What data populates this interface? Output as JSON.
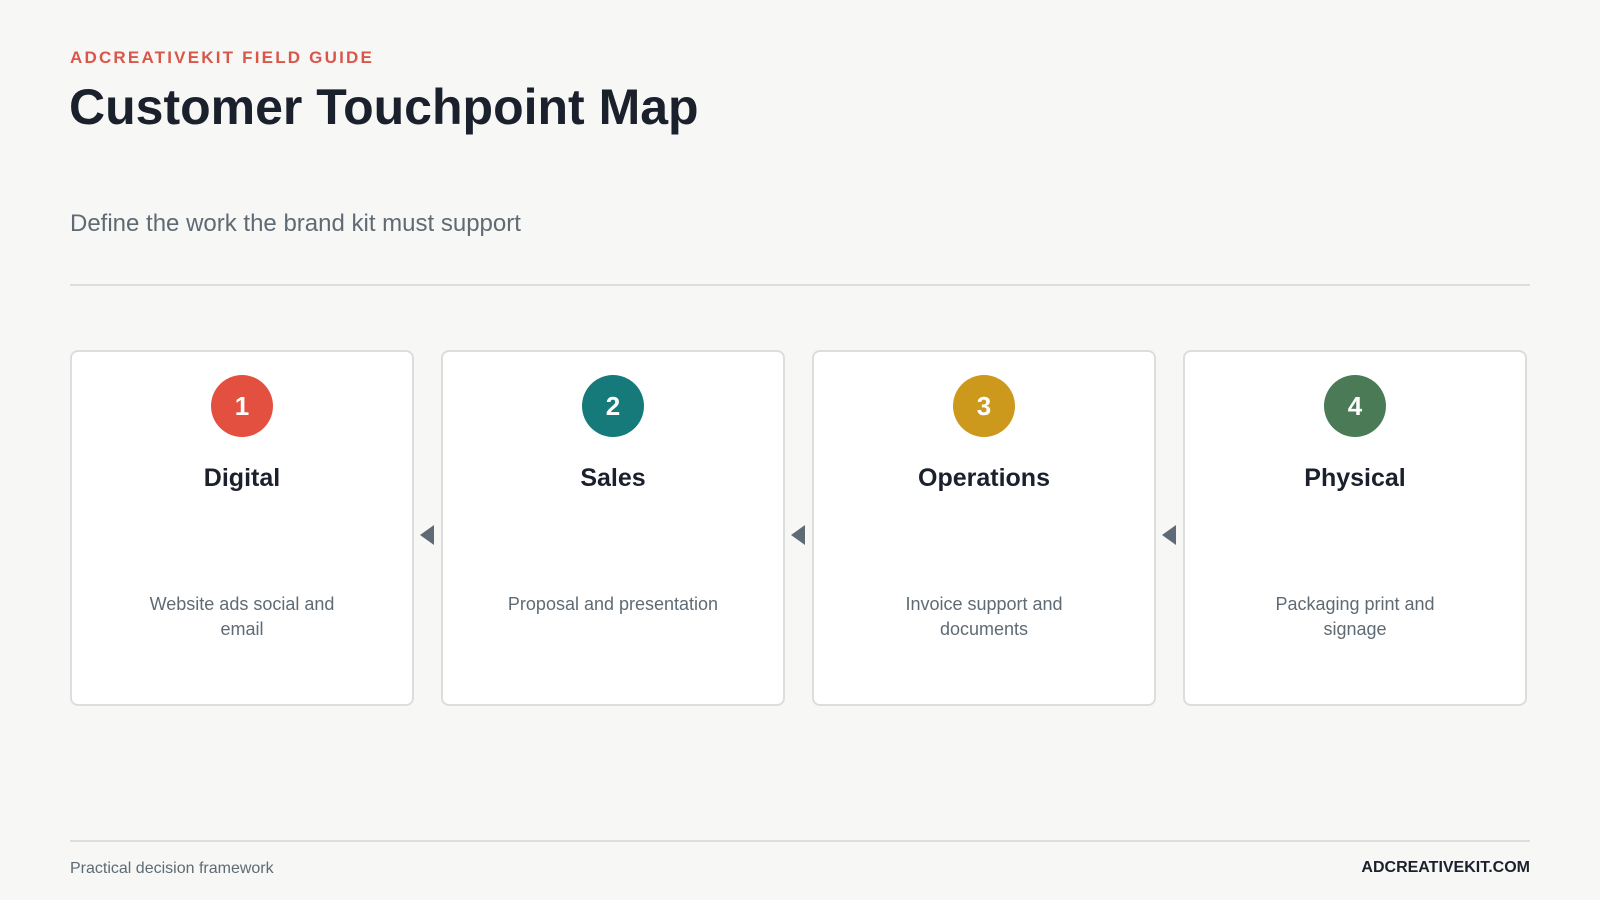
{
  "header": {
    "eyebrow": "ADCREATIVEKIT FIELD GUIDE",
    "title": "Customer Touchpoint Map",
    "subtitle": "Define the work the brand kit must support"
  },
  "cards": [
    {
      "number": "1",
      "title": "Digital",
      "description": "Website ads social and email",
      "color": "#e4503f"
    },
    {
      "number": "2",
      "title": "Sales",
      "description": "Proposal and presentation",
      "color": "#167a7a"
    },
    {
      "number": "3",
      "title": "Operations",
      "description": "Invoice support and documents",
      "color": "#cc991d"
    },
    {
      "number": "4",
      "title": "Physical",
      "description": "Packaging print and signage",
      "color": "#4a7a56"
    }
  ],
  "connectors": [
    {
      "icon": "triangle-left-icon",
      "color": "#5f6b74"
    },
    {
      "icon": "triangle-left-icon",
      "color": "#5f6b74"
    },
    {
      "icon": "triangle-left-icon",
      "color": "#5f6b74"
    }
  ],
  "footer": {
    "left": "Practical decision framework",
    "right": "ADCREATIVEKIT.COM"
  },
  "colors": {
    "background": "#f7f7f5",
    "accent": "#d9574a",
    "text": "#1a202c",
    "muted": "#5f6b74",
    "border": "#dcdedd"
  }
}
